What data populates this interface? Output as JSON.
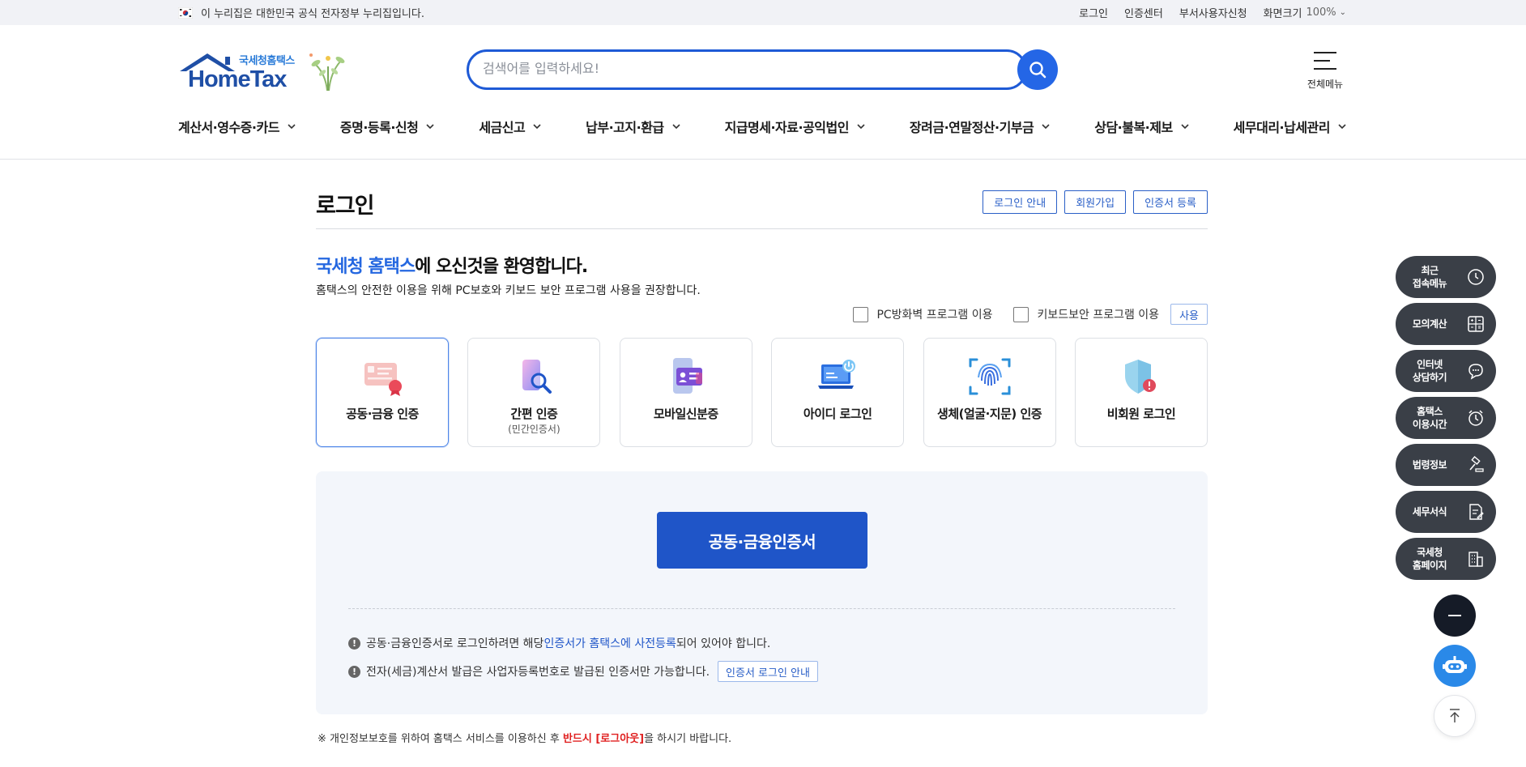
{
  "gov_bar": {
    "notice": "이 누리집은 대한민국 공식 전자정부 누리집입니다.",
    "links": [
      "로그인",
      "인증센터",
      "부서사용자신청"
    ],
    "zoom_label": "화면크기",
    "zoom_value": "100%"
  },
  "header": {
    "logo_sub": "국세청홈택스",
    "logo_main": "HomeTax",
    "search_placeholder": "검색어를 입력하세요!",
    "all_menu_label": "전체메뉴"
  },
  "gnb": [
    "계산서·영수증·카드",
    "증명·등록·신청",
    "세금신고",
    "납부·고지·환급",
    "지급명세·자료·공익법인",
    "장려금·연말정산·기부금",
    "상담·불복·제보",
    "세무대리·납세관리"
  ],
  "page": {
    "title": "로그인",
    "title_buttons": [
      "로그인 안내",
      "회원가입",
      "인증서 등록"
    ],
    "welcome_highlight": "국세청 홈택스",
    "welcome_rest": "에 오신것을 환영합니다.",
    "welcome_sub": "홈택스의 안전한 이용을 위해 PC보호와 키보드 보안 프로그램 사용을 권장합니다.",
    "option_firewall": "PC방화벽 프로그램 이용",
    "option_keyboard": "키보드보안 프로그램 이용",
    "use_button": "사용"
  },
  "login_methods": [
    {
      "label": "공동·금융 인증",
      "sub": "",
      "icon": "certificate-card-icon",
      "selected": true
    },
    {
      "label": "간편 인증",
      "sub": "(민간인증서)",
      "icon": "simple-auth-icon",
      "selected": false
    },
    {
      "label": "모바일신분증",
      "sub": "",
      "icon": "mobile-id-icon",
      "selected": false
    },
    {
      "label": "아이디 로그인",
      "sub": "",
      "icon": "laptop-login-icon",
      "selected": false
    },
    {
      "label": "생체(얼굴·지문) 인증",
      "sub": "",
      "icon": "fingerprint-icon",
      "selected": false
    },
    {
      "label": "비회원 로그인",
      "sub": "",
      "icon": "shield-icon",
      "selected": false
    }
  ],
  "panel": {
    "main_button": "공동·금융인증서",
    "note1_pre": "공동·금융인증서로 로그인하려면 해당 ",
    "note1_link": "인증서가 홈택스에 사전등록",
    "note1_post": "되어 있어야 합니다.",
    "note2": "전자(세금)계산서 발급은 사업자등록번호로 발급된 인증서만 가능합니다.",
    "note2_button": "인증서 로그인 안내"
  },
  "footnote": {
    "pre": "※ 개인정보보호를 위하여 홈택스 서비스를 이용하신 후 ",
    "red": "반드시 [로그아웃]",
    "post": "을 하시기 바랍니다."
  },
  "quick_menu": [
    {
      "label": "최근\n접속메뉴",
      "icon": "clock-icon"
    },
    {
      "label": "모의계산",
      "icon": "calculator-icon"
    },
    {
      "label": "인터넷\n상담하기",
      "icon": "chat-icon"
    },
    {
      "label": "홈택스\n이용시간",
      "icon": "alarm-icon"
    },
    {
      "label": "법령정보",
      "icon": "gavel-icon"
    },
    {
      "label": "세무서식",
      "icon": "form-icon"
    },
    {
      "label": "국세청\n홈페이지",
      "icon": "building-icon"
    }
  ],
  "colors": {
    "primary": "#1f55c8",
    "accent": "#2467e0",
    "quick_bg": "#3a3f47",
    "warning": "#e02020"
  }
}
